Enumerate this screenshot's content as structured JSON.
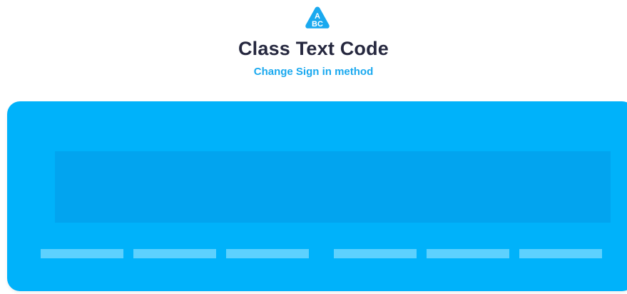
{
  "header": {
    "logo_icon": "abc-triangle-logo",
    "logo_letters": [
      "A",
      "BC"
    ],
    "title": "Class Text Code",
    "change_method_link": "Change Sign in method"
  },
  "code_entry": {
    "input_value": "",
    "slots_count": 6,
    "colors": {
      "card": "#00b2fa",
      "input": "#02a4ef",
      "slot": "#5dd1fe"
    }
  },
  "colors": {
    "title": "#26283f",
    "link": "#1aa9ef",
    "background": "#ffffff"
  }
}
